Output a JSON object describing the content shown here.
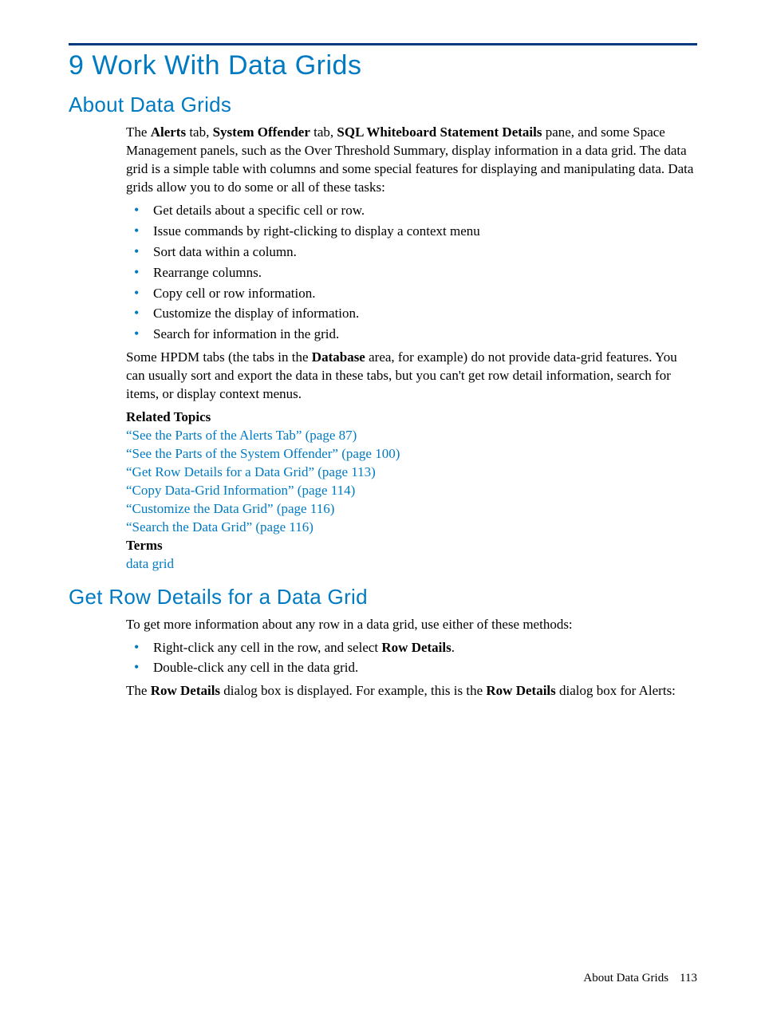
{
  "chapter": {
    "title": "9 Work With Data Grids"
  },
  "section1": {
    "title": "About Data Grids",
    "intro": {
      "pre": "The ",
      "b1": "Alerts",
      "mid1": " tab, ",
      "b2": "System Offender",
      "mid2": " tab, ",
      "b3": "SQL Whiteboard Statement Details",
      "post": " pane, and some Space Management panels, such as the Over Threshold Summary, display information in a data grid. The data grid is a simple table with columns and some special features for displaying and manipulating data. Data grids allow you to do some or all of these tasks:"
    },
    "bullets": [
      "Get details about a specific cell or row.",
      "Issue commands by right-clicking to display a context menu",
      "Sort data within a column.",
      "Rearrange columns.",
      "Copy cell or row information.",
      "Customize the display of information.",
      "Search for information in the grid."
    ],
    "note": {
      "pre": "Some HPDM tabs (the tabs in the ",
      "b1": "Database",
      "post": " area, for example) do not provide data-grid features. You can usually sort and export the data in these tabs, but you can't get row detail information, search for items, or display context menus."
    },
    "related_heading": "Related Topics",
    "related": [
      "“See the Parts of the Alerts Tab” (page 87)",
      "“See the Parts of the System Offender” (page 100)",
      "“Get Row Details for a Data Grid” (page 113)",
      "“Copy Data-Grid Information” (page 114)",
      "“Customize the Data Grid” (page 116)",
      "“Search the Data Grid” (page 116)"
    ],
    "terms_heading": "Terms",
    "terms": [
      "data grid"
    ]
  },
  "section2": {
    "title": "Get Row Details for a Data Grid",
    "intro": "To get more information about any row in a data grid, use either of these methods:",
    "bullets": [
      {
        "pre": "Right-click any cell in the row, and select ",
        "b": "Row Details",
        "post": "."
      },
      {
        "text": "Double-click any cell in the data grid."
      }
    ],
    "after": {
      "pre": "The ",
      "b1": "Row Details",
      "mid": " dialog box is displayed. For example, this is the ",
      "b2": "Row Details",
      "post": " dialog box for Alerts:"
    }
  },
  "footer": {
    "text": "About Data Grids",
    "page": "113"
  }
}
